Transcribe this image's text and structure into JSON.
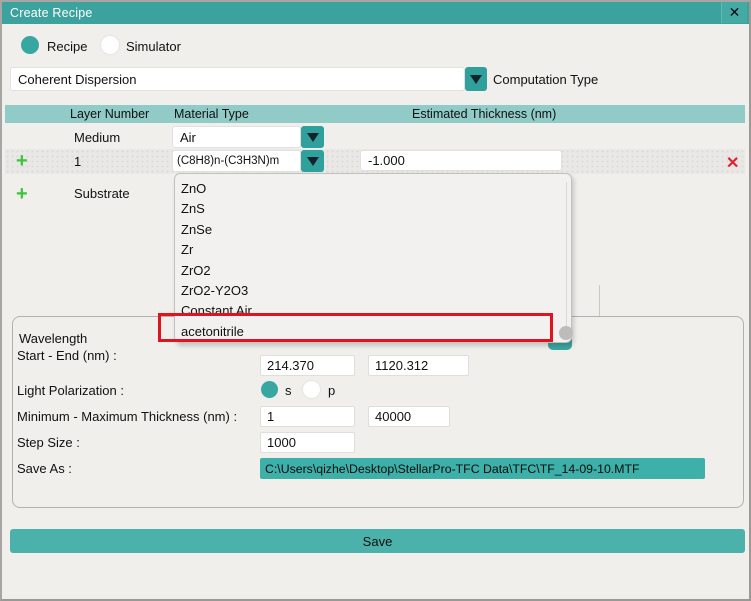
{
  "window": {
    "title": "Create Recipe",
    "close_label": "✕"
  },
  "mode_radios": {
    "recipe": {
      "label": "Recipe",
      "selected": true
    },
    "simulator": {
      "label": "Simulator",
      "selected": false
    }
  },
  "computation": {
    "selected_value": "Coherent Dispersion",
    "label": "Computation Type"
  },
  "table": {
    "headers": [
      "Layer Number",
      "Material Type",
      "Estimated Thickness (nm)"
    ],
    "rows": [
      {
        "layer": "Medium",
        "material": "Air",
        "thickness": ""
      },
      {
        "layer": "1",
        "material": "(C8H8)n-(C3H3N)m",
        "thickness": "-1.000",
        "add_label": "+",
        "delete_label": "✕"
      },
      {
        "layer": "Substrate",
        "material": "",
        "thickness": "",
        "add_label": "+"
      }
    ]
  },
  "material_dropdown": {
    "items": [
      "ZnO",
      "ZnS",
      "ZnSe",
      "Zr",
      "ZrO2",
      "ZrO2-Y2O3",
      "Constant Air",
      "acetonitrile"
    ],
    "highlighted_item": "acetonitrile",
    "highlight_color": "#e0131e"
  },
  "form": {
    "wavelength_label_line1": "Wavelength",
    "wavelength_label_line2": "Start - End (nm) :",
    "wavelength_start": "214.370",
    "wavelength_end": "1120.312",
    "polarization_label": "Light Polarization :",
    "polarization_s": "s",
    "polarization_p": "p",
    "polarization_selected": "s",
    "thickness_label": "Minimum - Maximum Thickness (nm) :",
    "thickness_min": "1",
    "thickness_max": "40000",
    "step_label": "Step Size :",
    "step_value": "1000",
    "saveas_label": "Save As :",
    "saveas_path": "C:\\Users\\qizhe\\Desktop\\StellarPro-TFC Data\\TFC\\TF_14-09-10.MTF"
  },
  "save_button": {
    "label": "Save"
  },
  "colors": {
    "titlebar": "#3ba29e",
    "table_header": "#90cbc8",
    "accent_teal": "#2fa09b",
    "save_button": "#4bb1ab",
    "saveas_band": "#3cb0a9",
    "add_green": "#3cc53c",
    "delete_red": "#e42330",
    "highlight_red": "#e0131e",
    "background": "#f0efec"
  }
}
